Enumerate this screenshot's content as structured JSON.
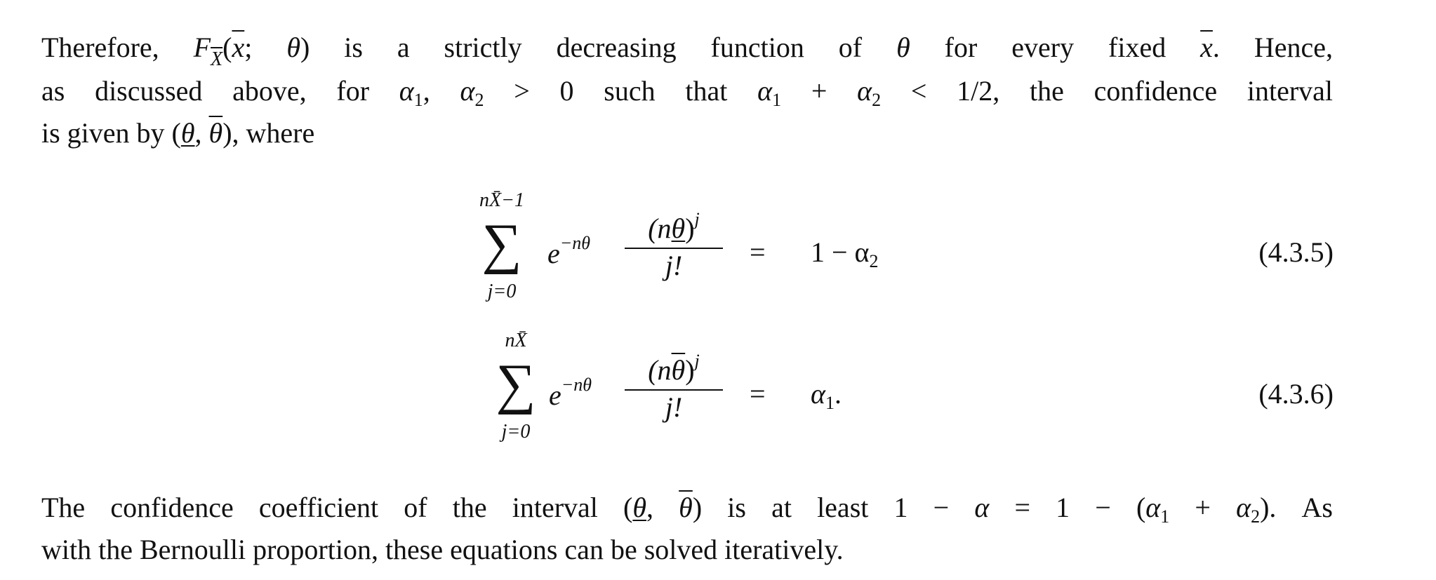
{
  "paragraph1": [
    [
      {
        "k": "t",
        "v": "Therefore, "
      },
      {
        "k": "i",
        "v": "F"
      },
      {
        "k": "subo",
        "v": "X"
      },
      {
        "k": "t",
        "v": "("
      },
      {
        "k": "o",
        "v": "x"
      },
      {
        "k": "t",
        "v": "; "
      },
      {
        "k": "i",
        "v": "θ"
      },
      {
        "k": "t",
        "v": ") is a strictly decreasing function of "
      },
      {
        "k": "i",
        "v": "θ"
      },
      {
        "k": "t",
        "v": " for every fixed "
      },
      {
        "k": "o",
        "v": "x"
      },
      {
        "k": "t",
        "v": ". Hence,"
      }
    ],
    [
      {
        "k": "t",
        "v": "as discussed above, for "
      },
      {
        "k": "i",
        "v": "α"
      },
      {
        "k": "sub",
        "v": "1"
      },
      {
        "k": "t",
        "v": ", "
      },
      {
        "k": "i",
        "v": "α"
      },
      {
        "k": "sub",
        "v": "2"
      },
      {
        "k": "t",
        "v": " > 0 such that "
      },
      {
        "k": "i",
        "v": "α"
      },
      {
        "k": "sub",
        "v": "1"
      },
      {
        "k": "t",
        "v": " + "
      },
      {
        "k": "i",
        "v": "α"
      },
      {
        "k": "sub",
        "v": "2"
      },
      {
        "k": "t",
        "v": " < 1/2, the confidence interval"
      }
    ],
    [
      {
        "k": "t",
        "v": "is given by ("
      },
      {
        "k": "u",
        "v": "θ"
      },
      {
        "k": "t",
        "v": ", "
      },
      {
        "k": "o",
        "v": "θ"
      },
      {
        "k": "t",
        "v": "), where"
      }
    ]
  ],
  "equations": [
    {
      "upper": "nX̄−1",
      "lower": "j=0",
      "sigma": "∑",
      "exp": "−nθ",
      "num_open": "(n",
      "num_theta": "θ",
      "num_close": ")",
      "num_sup": "j",
      "den": "j!",
      "equals": "=",
      "rhs": "1 − α",
      "rhs_sub": "2",
      "rhs_tail": "",
      "number": "(4.3.5)"
    },
    {
      "upper": "nX̄",
      "lower": "j=0",
      "sigma": "∑",
      "exp": "−nθ",
      "num_open": "(n",
      "num_theta": "θ",
      "num_close": ")",
      "num_sup": "j",
      "den": "j!",
      "equals": "=",
      "rhs": "α",
      "rhs_sub": "1",
      "rhs_tail": ".",
      "number": "(4.3.6)"
    }
  ],
  "paragraph2": [
    [
      {
        "k": "t",
        "v": "The confidence coefficient of the interval ("
      },
      {
        "k": "u",
        "v": "θ"
      },
      {
        "k": "t",
        "v": ", "
      },
      {
        "k": "o",
        "v": "θ"
      },
      {
        "k": "t",
        "v": ") is at least 1 − "
      },
      {
        "k": "i",
        "v": "α"
      },
      {
        "k": "t",
        "v": " = 1 − ("
      },
      {
        "k": "i",
        "v": "α"
      },
      {
        "k": "sub",
        "v": "1"
      },
      {
        "k": "t",
        "v": " + "
      },
      {
        "k": "i",
        "v": "α"
      },
      {
        "k": "sub",
        "v": "2"
      },
      {
        "k": "t",
        "v": ").  As"
      }
    ],
    [
      {
        "k": "t",
        "v": "with the Bernoulli proportion, these equations can be solved iteratively."
      }
    ]
  ]
}
